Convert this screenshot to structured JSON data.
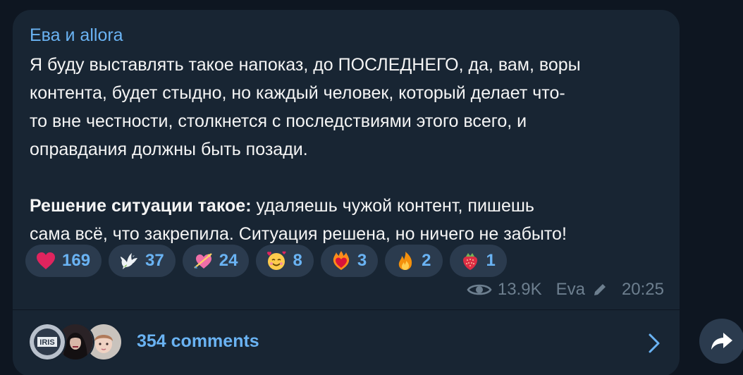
{
  "post": {
    "sender": "Ева и allora",
    "paragraph1_lines": [
      "Я буду выставлять такое напоказ, до ПОСЛЕДНЕГО, да, вам, воры",
      "контента, будет стыдно, но каждый человек, который делает что-",
      "то вне честности, столкнется с последствиями этого всего, и",
      "оправдания должны быть позади."
    ],
    "paragraph2_bold": "Решение ситуации такое:",
    "paragraph2_line1_rest": " удаляешь чужой контент, пишешь",
    "paragraph2_line2": "сама всё, что закрепила. Ситуация решена, но ничего не забыто!"
  },
  "reactions": [
    {
      "icon": "heart-emoji",
      "count": "169"
    },
    {
      "icon": "dove-emoji",
      "count": "37"
    },
    {
      "icon": "heart-arrow-emoji",
      "count": "24"
    },
    {
      "icon": "smiling-face-hearts-emoji",
      "count": "8"
    },
    {
      "icon": "heart-on-fire-emoji",
      "count": "3"
    },
    {
      "icon": "fire-emoji",
      "count": "2"
    },
    {
      "icon": "strawberry-emoji",
      "count": "1"
    }
  ],
  "meta": {
    "views": "13.9K",
    "author": "Eva",
    "time": "20:25",
    "views_icon": "eye-icon",
    "edited_icon": "pencil-icon"
  },
  "comments": {
    "label": "354 comments",
    "avatar_text": "IRIS"
  },
  "colors": {
    "background": "#0e1621",
    "bubble": "#182533",
    "accent": "#6ab3f3",
    "text": "#f5f5f5",
    "muted": "#6d7f8f",
    "pill": "#2b3b4e"
  }
}
